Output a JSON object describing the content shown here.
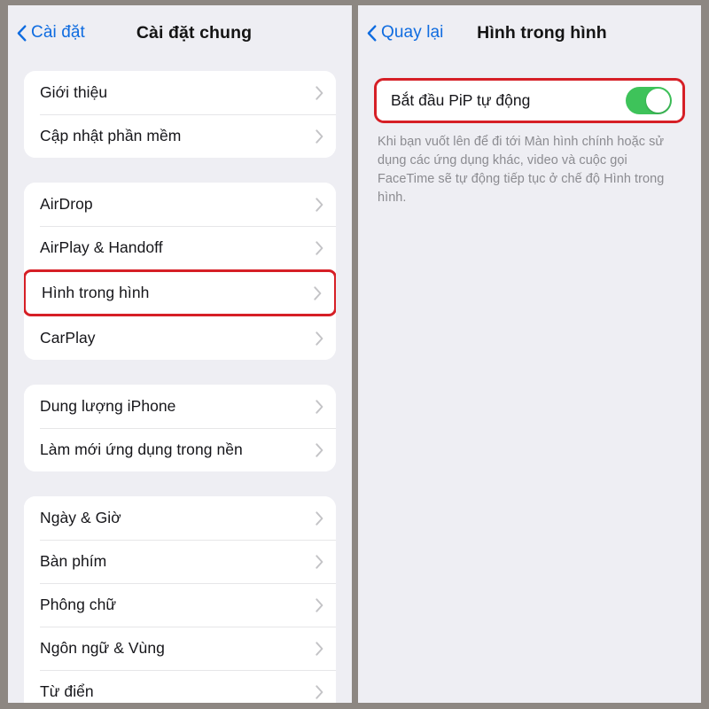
{
  "colors": {
    "accent_blue": "#0f6ce0",
    "highlight_red": "#d61f26",
    "toggle_green": "#3ec35a",
    "page_background": "#eeeef3",
    "card_background": "#ffffff",
    "frame_gray": "#8d8782",
    "label_text": "#16161a",
    "footnote_text": "#8b8b90"
  },
  "left_panel": {
    "nav": {
      "back_label": "Cài đặt",
      "back_icon": "chevron-left-icon",
      "title": "Cài đặt chung"
    },
    "sections": [
      {
        "rows": [
          {
            "label": "Giới thiệu",
            "accessory": "chevron-right-icon",
            "highlighted": false
          },
          {
            "label": "Cập nhật phần mềm",
            "accessory": "chevron-right-icon",
            "highlighted": false
          }
        ]
      },
      {
        "rows": [
          {
            "label": "AirDrop",
            "accessory": "chevron-right-icon",
            "highlighted": false
          },
          {
            "label": "AirPlay & Handoff",
            "accessory": "chevron-right-icon",
            "highlighted": false
          },
          {
            "label": "Hình trong hình",
            "accessory": "chevron-right-icon",
            "highlighted": true
          },
          {
            "label": "CarPlay",
            "accessory": "chevron-right-icon",
            "highlighted": false
          }
        ]
      },
      {
        "rows": [
          {
            "label": "Dung lượng iPhone",
            "accessory": "chevron-right-icon",
            "highlighted": false
          },
          {
            "label": "Làm mới ứng dụng trong nền",
            "accessory": "chevron-right-icon",
            "highlighted": false
          }
        ]
      },
      {
        "rows": [
          {
            "label": "Ngày & Giờ",
            "accessory": "chevron-right-icon",
            "highlighted": false
          },
          {
            "label": "Bàn phím",
            "accessory": "chevron-right-icon",
            "highlighted": false
          },
          {
            "label": "Phông chữ",
            "accessory": "chevron-right-icon",
            "highlighted": false
          },
          {
            "label": "Ngôn ngữ & Vùng",
            "accessory": "chevron-right-icon",
            "highlighted": false
          },
          {
            "label": "Từ điển",
            "accessory": "chevron-right-icon",
            "highlighted": false
          }
        ]
      }
    ]
  },
  "right_panel": {
    "nav": {
      "back_label": "Quay lại",
      "back_icon": "chevron-left-icon",
      "title": "Hình trong hình"
    },
    "toggle": {
      "label": "Bắt đầu PiP tự động",
      "state": "on",
      "highlighted": true
    },
    "footnote": "Khi bạn vuốt lên để đi tới Màn hình chính hoặc sử dụng các ứng dụng khác, video và cuộc gọi FaceTime sẽ tự động tiếp tục ở chế độ Hình trong hình."
  }
}
